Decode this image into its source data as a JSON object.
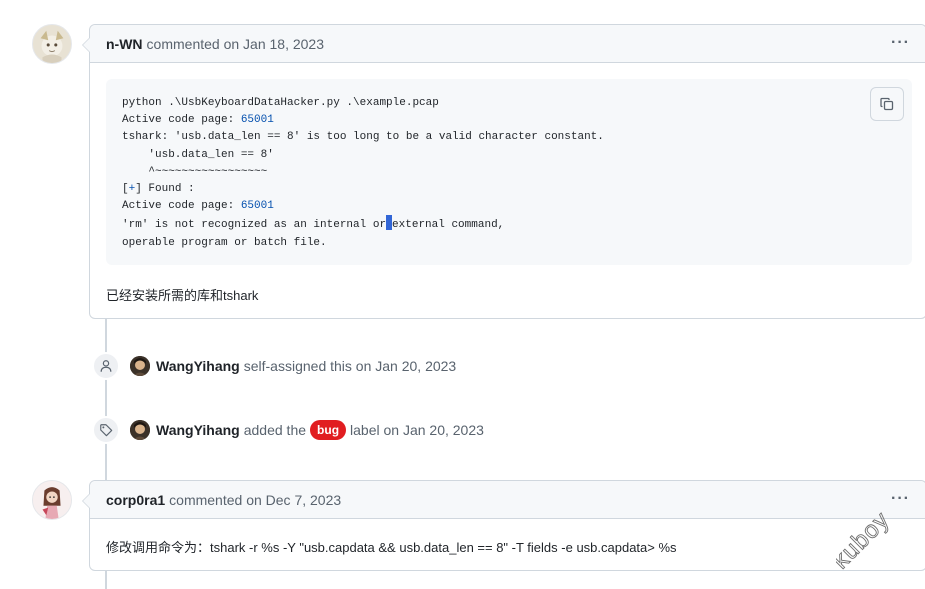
{
  "comment1": {
    "author": "n-WN",
    "meta": "commented on Jan 18, 2023",
    "more_label": "···",
    "code": {
      "lines": [
        "python .\\UsbKeyboardDataHacker.py .\\example.pcap",
        "Active code page: ",
        "tshark: 'usb.data_len == 8' is too long to be a valid character constant.",
        "    'usb.data_len == 8'",
        "    ^~~~~~~~~~~~~~~~~~",
        "[",
        "Active code page: ",
        "'rm' is not recognized as an internal or",
        "operable program or batch file."
      ],
      "code_page_1": "65001",
      "code_page_2": "65001",
      "found_plus": "+",
      "found_rest": "] Found :",
      "rm_tail": "external command,"
    },
    "body": "已经安装所需的库和tshark"
  },
  "event1": {
    "user": "WangYihang",
    "text": "self-assigned this on Jan 20, 2023"
  },
  "event2": {
    "user": "WangYihang",
    "text_before": "added the",
    "label": "bug",
    "text_after": "label on Jan 20, 2023"
  },
  "comment2": {
    "author": "corp0ra1",
    "meta": "commented on Dec 7, 2023",
    "more_label": "···",
    "body": "修改调用命令为：tshark -r %s -Y \"usb.capdata && usb.data_len == 8\" -T fields -e usb.capdata> %s"
  },
  "watermark": "kuboy",
  "colors": {
    "bug_label": "#e11d21",
    "number_highlight": "#0550ae",
    "cursor": "#3266d6"
  },
  "icons": {
    "copy": "copy-icon",
    "person": "person-icon",
    "tag": "tag-icon",
    "more": "kebab-horizontal-icon"
  }
}
